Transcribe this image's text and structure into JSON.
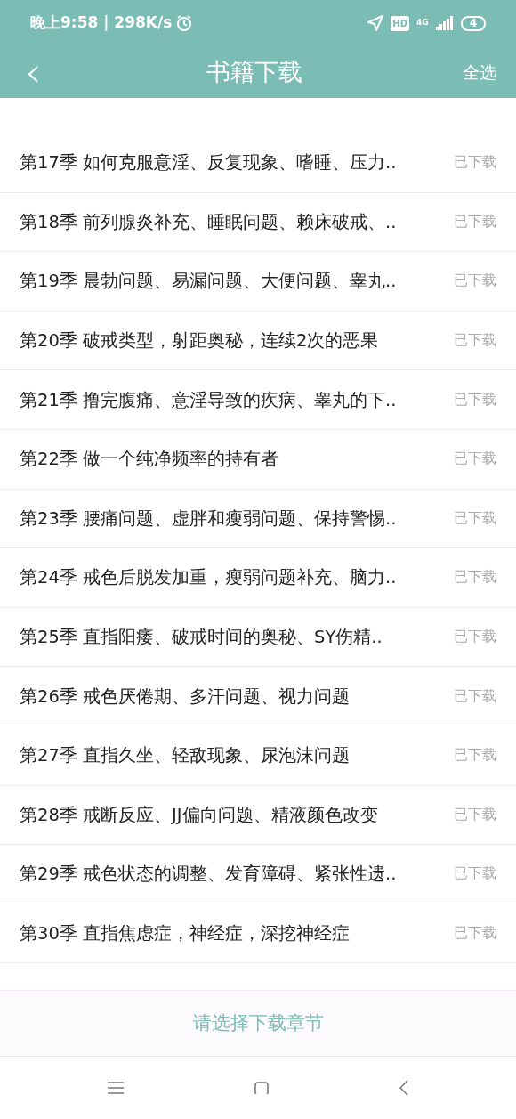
{
  "status_bar": {
    "time": "晚上9:58 | 298K/s",
    "hd": "HD",
    "network": "4G",
    "battery": "4"
  },
  "header": {
    "back": "‹",
    "title": "书籍下载",
    "select_all": "全选"
  },
  "chapters": [
    {
      "title": "第17季 如何克服意淫、反复现象、嗜睡、压力..",
      "status": "已下载"
    },
    {
      "title": "第18季 前列腺炎补充、睡眠问题、赖床破戒、..",
      "status": "已下载"
    },
    {
      "title": "第19季 晨勃问题、易漏问题、大便问题、睾丸..",
      "status": "已下载"
    },
    {
      "title": "第20季 破戒类型，射距奥秘，连续2次的恶果",
      "status": "已下载"
    },
    {
      "title": "第21季 撸完腹痛、意淫导致的疾病、睾丸的下..",
      "status": "已下载"
    },
    {
      "title": "第22季 做一个纯净频率的持有者",
      "status": "已下载"
    },
    {
      "title": "第23季 腰痛问题、虚胖和瘦弱问题、保持警惕..",
      "status": "已下载"
    },
    {
      "title": "第24季 戒色后脱发加重，瘦弱问题补充、脑力..",
      "status": "已下载"
    },
    {
      "title": "第25季 直指阳痿、破戒时间的奥秘、SY伤精..",
      "status": "已下载"
    },
    {
      "title": "第26季 戒色厌倦期、多汗问题、视力问题",
      "status": "已下载"
    },
    {
      "title": "第27季 直指久坐、轻敌现象、尿泡沫问题",
      "status": "已下载"
    },
    {
      "title": "第28季 戒断反应、JJ偏向问题、精液颜色改变",
      "status": "已下载"
    },
    {
      "title": "第29季 戒色状态的调整、发育障碍、紧张性遗..",
      "status": "已下载"
    },
    {
      "title": "第30季 直指焦虑症，神经症，深挖神经症",
      "status": "已下载"
    }
  ],
  "footer": {
    "prompt": "请选择下载章节"
  }
}
